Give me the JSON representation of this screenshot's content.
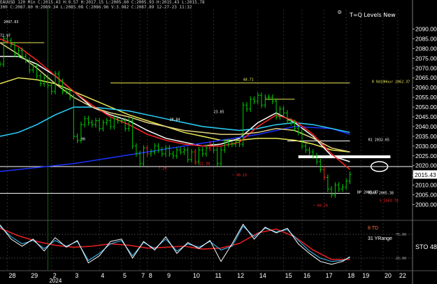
{
  "header": {
    "line1": "EAUUSD 120 Min C:2015.43 H:9.57 H:2017.15 L:2005.60 C:2005.93 H:2015.43 L:2015.78",
    "line2": "300 C:2087.80 H:2089.34 L:2085.08 C:2086.96 V:3.982 C:2087.89 12-27-23 11:32",
    "title": "T=Q Levels New",
    "gear_icon": "gear-icon"
  },
  "colors": {
    "background": "#000000",
    "price_bar": "#00cc00",
    "yellow_line": "#e8e855",
    "white_line": "#ffffff",
    "blue_line": "#1a33ff",
    "cyan_line": "#2ad4ff",
    "red_line": "#ff2222",
    "khaki_line": "#e0d080",
    "osc_red": "#e02020",
    "osc_cyan": "#40c0ff",
    "osc_white": "#ffffff"
  },
  "chart_data": {
    "type": "line",
    "symbol": "EAUUSD",
    "interval": "120 Min",
    "x_tick_labels": [
      "28",
      "29",
      "2",
      "3",
      "4",
      "5",
      "7",
      "8",
      "9",
      "10",
      "11",
      "12",
      "14",
      "15",
      "16",
      "17",
      "18",
      "19",
      "20",
      "22"
    ],
    "x_tick_positions": [
      2,
      8,
      14,
      20,
      27,
      33,
      38,
      40,
      45,
      52,
      58,
      64,
      70,
      77,
      82,
      88,
      94,
      98,
      104,
      108
    ],
    "x_axis_year": "2024",
    "x_range": [
      0,
      112
    ],
    "ylim": [
      1993,
      2097
    ],
    "y_ticks": [
      2000,
      2005,
      2010,
      2015,
      2020,
      2025,
      2030,
      2035,
      2040,
      2045,
      2050,
      2055,
      2060,
      2065,
      2070,
      2075,
      2080,
      2085,
      2090
    ],
    "y_tick_labels": [
      "2000.00",
      "2005.00",
      "2010.00",
      "2015.00",
      "2020.00",
      "2025.00",
      "2030.00",
      "2035.00",
      "2040.00",
      "2045.00",
      "2050.00",
      "2055.00",
      "2060.00",
      "2065.00",
      "2070.00",
      "2075.00",
      "2080.00",
      "2085.00",
      "2090.00"
    ],
    "last_price": 2015.43,
    "last_price_label": "2015.43",
    "price": {
      "x": [
        0,
        1,
        2,
        3,
        4,
        5,
        6,
        7,
        8,
        9,
        10,
        11,
        12,
        13,
        14,
        15,
        16,
        17,
        18,
        19,
        20,
        21,
        22,
        23,
        24,
        25,
        26,
        27,
        28,
        29,
        30,
        31,
        32,
        33,
        34,
        35,
        36,
        37,
        38,
        39,
        40,
        41,
        42,
        43,
        44,
        45,
        46,
        47,
        48,
        49,
        50,
        51,
        52,
        53,
        54,
        55,
        56,
        57,
        58,
        59,
        60,
        61,
        62,
        63,
        64,
        65,
        66,
        67,
        68,
        69,
        70,
        71,
        72,
        73,
        74,
        75,
        76,
        77,
        78,
        79,
        80,
        81,
        82,
        83,
        84,
        85,
        86,
        87,
        88,
        89,
        90,
        91,
        92,
        93,
        94,
        95
      ],
      "y": [
        2072,
        2085,
        2084,
        2082,
        2077,
        2079,
        2076,
        2074,
        2069,
        2071,
        2066,
        2062,
        2065,
        2061,
        2058,
        2067,
        2063,
        2058,
        2058,
        2055,
        2035,
        2033,
        2041,
        2044,
        2042,
        2041,
        2043,
        2039,
        2042,
        2043,
        2040,
        2044,
        2043,
        2043,
        2039,
        2043,
        2030,
        2026,
        2021,
        2029,
        2026,
        2027,
        2030,
        2028,
        2026,
        2029,
        2026,
        2025,
        2028,
        2027,
        2028,
        2023,
        2027,
        2022,
        2028,
        2026,
        2029,
        2031,
        2028,
        2021,
        2028,
        2032,
        2031,
        2031,
        2032,
        2031,
        2051,
        2049,
        2054,
        2053,
        2056,
        2051,
        2055,
        2055,
        2053,
        2045,
        2049,
        2047,
        2043,
        2042,
        2039,
        2037,
        2030,
        2028,
        2027,
        2025,
        2022,
        2018,
        2014,
        2008,
        2005,
        2010,
        2008,
        2009,
        2012,
        2015.43
      ]
    },
    "series": [
      {
        "color": "yellow_line",
        "x": [
          0,
          5,
          10,
          15,
          20,
          25,
          30,
          35,
          40,
          45,
          50,
          55,
          60,
          65,
          70,
          75,
          80,
          85,
          90,
          95
        ],
        "y": [
          2062,
          2065,
          2064,
          2062,
          2058,
          2054,
          2050,
          2046,
          2043,
          2040,
          2037,
          2035,
          2033,
          2033,
          2034,
          2034,
          2033,
          2031,
          2028,
          2027
        ]
      },
      {
        "color": "white_line",
        "x": [
          0,
          5,
          10,
          15,
          20,
          25,
          30,
          35,
          40,
          45,
          50,
          55,
          60,
          65,
          70,
          75,
          80,
          85,
          90,
          95
        ],
        "y": [
          2076,
          2076,
          2072,
          2066,
          2058,
          2050,
          2046,
          2043,
          2038,
          2034,
          2032,
          2030,
          2031,
          2034,
          2042,
          2047,
          2042,
          2035,
          2025,
          2022
        ]
      },
      {
        "color": "blue_line",
        "x": [
          0,
          10,
          20,
          30,
          40,
          50,
          60,
          70,
          80,
          90,
          95
        ],
        "y": [
          2017,
          2019,
          2021,
          2024,
          2027,
          2030,
          2033,
          2036,
          2040,
          2039,
          2036
        ]
      },
      {
        "color": "cyan_line",
        "x": [
          0,
          5,
          10,
          15,
          20,
          25,
          30,
          35,
          40,
          45,
          50,
          55,
          60,
          65,
          70,
          75,
          80,
          85,
          90,
          95
        ],
        "y": [
          2035,
          2037,
          2041,
          2046,
          2050,
          2050,
          2049,
          2048,
          2046,
          2044,
          2042,
          2040,
          2039,
          2038,
          2039,
          2041,
          2042,
          2041,
          2039,
          2037
        ]
      },
      {
        "color": "red_line",
        "x": [
          0,
          5,
          10,
          15,
          20,
          25,
          30,
          35,
          40,
          45,
          50,
          55,
          60,
          65,
          70,
          75,
          80,
          85,
          90,
          95
        ],
        "y": [
          2085,
          2081,
          2074,
          2066,
          2058,
          2051,
          2045,
          2041,
          2036,
          2033,
          2031,
          2030,
          2030,
          2032,
          2040,
          2046,
          2043,
          2036,
          2026,
          2018
        ]
      },
      {
        "color": "khaki_line",
        "x": [
          0,
          5,
          10,
          15,
          20,
          25,
          30,
          35,
          40,
          45,
          50,
          55,
          60,
          65,
          70,
          75,
          80,
          85,
          90,
          95
        ],
        "y": [
          2083,
          2077,
          2070,
          2062,
          2055,
          2050,
          2047,
          2045,
          2042,
          2040,
          2038,
          2037,
          2036,
          2036,
          2037,
          2039,
          2038,
          2034,
          2029,
          2027
        ]
      }
    ],
    "horizontal_levels": [
      {
        "y": 2083,
        "x0": 0,
        "x1": 12,
        "color": "yellow_line"
      },
      {
        "y": 2062.37,
        "x0": 30,
        "x1": 95,
        "color": "yellow_line"
      },
      {
        "y": 2054,
        "x0": 72,
        "x1": 80,
        "color": "yellow_line"
      },
      {
        "y": 2032.65,
        "x0": 78,
        "x1": 95,
        "color": "white_line"
      },
      {
        "y": 2024.5,
        "x0": 81,
        "x1": 106,
        "color": "white_line",
        "thick": true
      },
      {
        "y": 2019.5,
        "x0": 0,
        "x1": 112,
        "color": "white_line"
      },
      {
        "y": 2005.77,
        "x0": 0,
        "x1": 95,
        "color": "white_line"
      }
    ],
    "text_labels": [
      {
        "text": "2097.03",
        "x": 1,
        "y": 2093,
        "color": "white_line"
      },
      {
        "text": "72.97",
        "x": 0,
        "y": 2086,
        "color": "white_line"
      },
      {
        "text": "48.71",
        "x": 66,
        "y": 2063.5,
        "color": "yellow_line"
      },
      {
        "text": "R Rd10Hour 2062.37",
        "x": 101,
        "y": 2062.4,
        "color": "yellow_line"
      },
      {
        "text": "23.85",
        "x": 58,
        "y": 2047,
        "color": "white_line"
      },
      {
        "text": "28.84",
        "x": 46,
        "y": 2043,
        "color": "white_line"
      },
      {
        "text": "90",
        "x": 22,
        "y": 2033,
        "color": "white_line"
      },
      {
        "text": "R1 2032.65",
        "x": 100,
        "y": 2032.7,
        "color": "white_line"
      },
      {
        "text": "~ 21.38",
        "x": 53,
        "y": 2020.5,
        "color": "red_line"
      },
      {
        "text": "7.28",
        "x": 43,
        "y": 2018,
        "color": "red_line"
      },
      {
        "text": "~ 30.13",
        "x": 63,
        "y": 2014.5,
        "color": "red_line"
      },
      {
        "text": "BP 2005.77",
        "x": 97,
        "y": 2005.8,
        "color": "white_line"
      },
      {
        "text": "R5RR 2005.38",
        "x": 100,
        "y": 2005.4,
        "color": "white_line"
      },
      {
        "text": "S 2003.78",
        "x": 103,
        "y": 2001.5,
        "color": "red_line"
      },
      {
        "text": "~ 60.29",
        "x": 85,
        "y": 1999,
        "color": "red_line"
      }
    ],
    "marker_ellipse": {
      "x": 103,
      "y": 2019.5
    },
    "oscillator": {
      "title": "STO",
      "value_label": "48",
      "legend": [
        "8 TD",
        "31 YRange"
      ],
      "ylim": [
        0,
        100
      ],
      "y_tick_labels": [
        "75.00",
        "25.00"
      ],
      "y_ticks": [
        75,
        25
      ],
      "red": {
        "x": [
          0,
          5,
          10,
          15,
          20,
          25,
          30,
          35,
          40,
          45,
          50,
          55,
          60,
          65,
          70,
          75,
          80,
          85,
          90,
          95
        ],
        "y": [
          88,
          72,
          60,
          52,
          48,
          50,
          55,
          52,
          46,
          48,
          50,
          44,
          46,
          56,
          78,
          86,
          70,
          42,
          22,
          22
        ]
      },
      "cyan": {
        "x": [
          0,
          3,
          6,
          9,
          12,
          15,
          18,
          21,
          24,
          27,
          30,
          33,
          36,
          39,
          42,
          45,
          48,
          51,
          54,
          57,
          60,
          63,
          66,
          69,
          72,
          75,
          78,
          81,
          84,
          87,
          90,
          93,
          95
        ],
        "y": [
          92,
          70,
          55,
          62,
          45,
          62,
          50,
          60,
          20,
          35,
          55,
          62,
          30,
          58,
          45,
          65,
          40,
          55,
          48,
          60,
          42,
          50,
          92,
          70,
          88,
          80,
          85,
          62,
          40,
          25,
          18,
          20,
          26
        ]
      },
      "white": {
        "x": [
          0,
          3,
          6,
          9,
          12,
          15,
          18,
          21,
          24,
          27,
          30,
          33,
          36,
          39,
          42,
          45,
          48,
          51,
          54,
          57,
          60,
          63,
          66,
          69,
          72,
          75,
          78,
          81,
          84,
          87,
          90,
          93,
          95
        ],
        "y": [
          95,
          65,
          50,
          65,
          40,
          68,
          48,
          62,
          15,
          30,
          60,
          65,
          25,
          60,
          42,
          70,
          35,
          58,
          45,
          62,
          18,
          55,
          96,
          65,
          90,
          78,
          88,
          55,
          35,
          18,
          12,
          18,
          28
        ]
      }
    }
  }
}
